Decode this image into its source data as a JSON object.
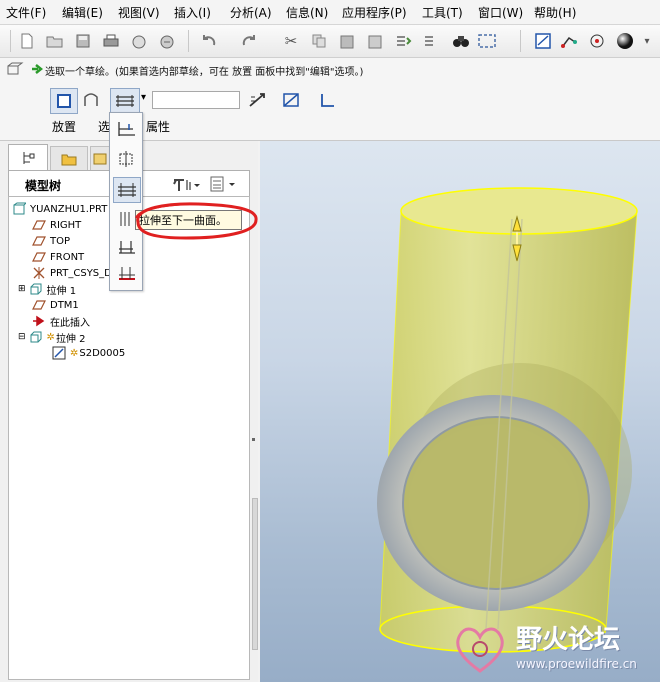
{
  "menubar": {
    "items": [
      "文件(F)",
      "编辑(E)",
      "视图(V)",
      "插入(I)",
      "分析(A)",
      "信息(N)",
      "应用程序(P)",
      "工具(T)",
      "窗口(W)",
      "帮助(H)"
    ]
  },
  "toolbar": {
    "icons": [
      "new-icon",
      "open-icon",
      "save-icon",
      "print-icon",
      "send-icon",
      "email-icon",
      "undo-icon",
      "redo-icon",
      "cut-icon",
      "copy-icon",
      "paste-icon",
      "paste-special-icon",
      "regenerate-icon",
      "find-icon",
      "select-box-icon",
      "sketch-icon",
      "datum-icon",
      "spin-center-icon",
      "shade-icon"
    ]
  },
  "dashboard": {
    "message": "选取一个草绘。(如果首选内部草绘，可在 放置 面板中找到\"编辑\"选项。)",
    "depth_value": "",
    "tabs": {
      "placement": "放置",
      "options": "选",
      "properties": "属性"
    }
  },
  "dropdown": {
    "tooltip": "拉伸至下一曲面。"
  },
  "panel": {
    "title": "模型树"
  },
  "tree": [
    {
      "label": "YUANZHU1.PRT",
      "icon": "part-icon"
    },
    {
      "label": "RIGHT",
      "icon": "datum-plane-icon"
    },
    {
      "label": "TOP",
      "icon": "datum-plane-icon"
    },
    {
      "label": "FRONT",
      "icon": "datum-plane-icon"
    },
    {
      "label": "PRT_CSYS_D",
      "icon": "csys-icon"
    },
    {
      "label": "拉伸 1",
      "icon": "extrude-icon"
    },
    {
      "label": "DTM1",
      "icon": "datum-plane-icon"
    },
    {
      "label": "在此插入",
      "icon": "insert-here-icon"
    },
    {
      "label": "拉伸 2",
      "icon": "extrude-icon"
    },
    {
      "label": "S2D0005",
      "icon": "sketch-icon"
    }
  ],
  "watermark": {
    "brand": "野火论坛",
    "url": "www.proewildfire.cn"
  },
  "colors": {
    "model": "#d4d35e",
    "highlight": "#ffff00",
    "annotation": "#e02020",
    "tree_bg": "#ffffff"
  }
}
